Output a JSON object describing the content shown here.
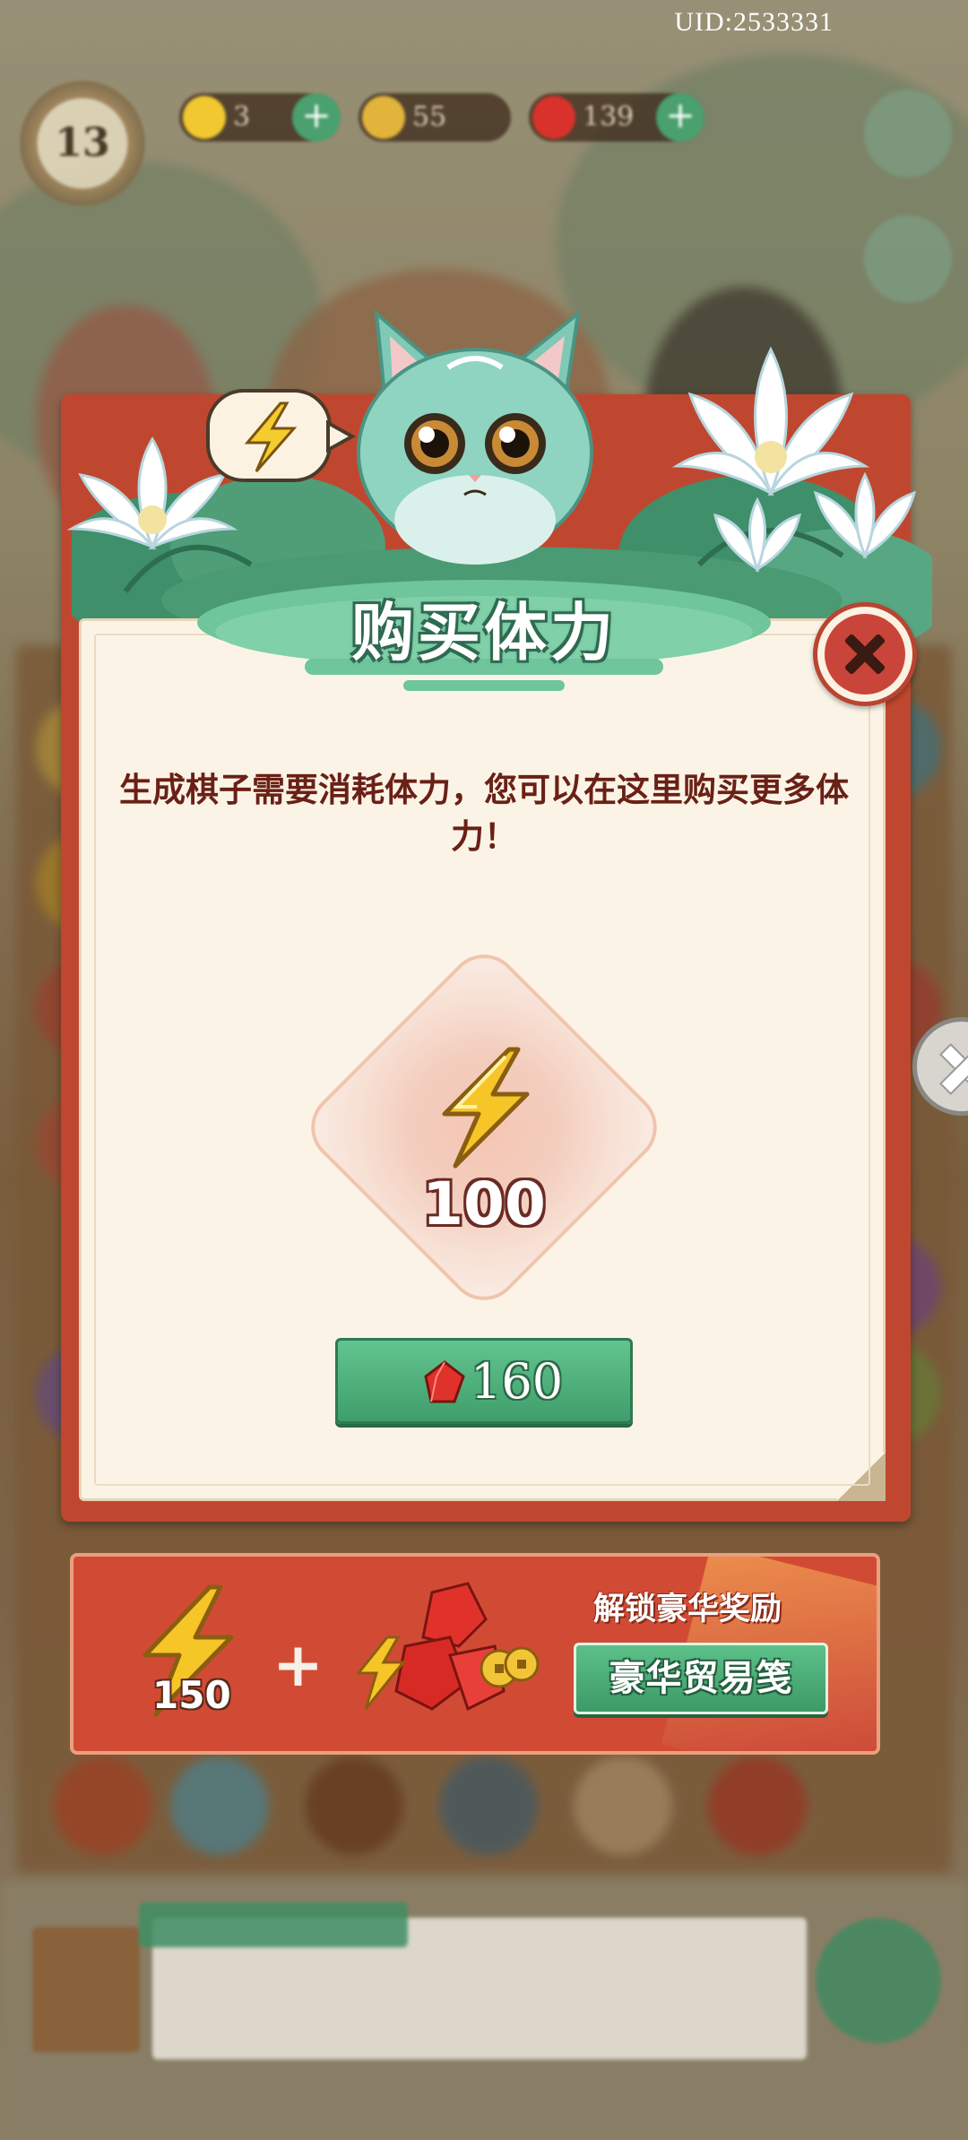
{
  "header": {
    "uid_text": "UID:2533331",
    "level": "13",
    "resources": [
      {
        "name": "energy",
        "value": "3",
        "icon": "lightning-icon",
        "color": "#f2c830"
      },
      {
        "name": "coins",
        "value": "55",
        "icon": "coin-icon",
        "color": "#e3b43c"
      },
      {
        "name": "gems",
        "value": "139",
        "icon": "gem-icon",
        "color": "#d8322b"
      }
    ]
  },
  "popup": {
    "title": "购买体力",
    "description": "生成棋子需要消耗体力，您可以在这里购买更多体力！",
    "reward": {
      "icon": "lightning-icon",
      "amount": "100"
    },
    "buy_button": {
      "currency_icon": "gem-icon",
      "price": "160"
    },
    "close_icon": "close-icon"
  },
  "premium_banner": {
    "energy_amount": "150",
    "caption": "解锁豪华奖励",
    "button_label": "豪华贸易笺"
  },
  "colors": {
    "panel_red": "#c0472f",
    "paper": "#fbf4e6",
    "button_green": "#4fae7a",
    "text_dark_red": "#6a2016"
  }
}
